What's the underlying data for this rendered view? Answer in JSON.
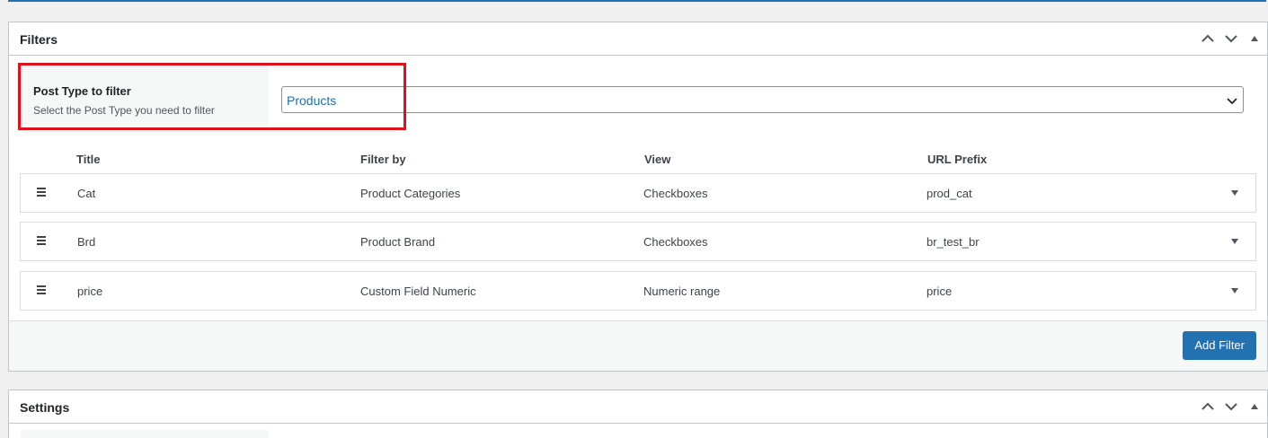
{
  "filters_box": {
    "title": "Filters",
    "post_type": {
      "label": "Post Type to filter",
      "description": "Select the Post Type you need to filter",
      "selected": "Products"
    },
    "columns": [
      "Title",
      "Filter by",
      "View",
      "URL Prefix"
    ],
    "rows": [
      {
        "title": "Cat",
        "filter_by": "Product Categories",
        "view": "Checkboxes",
        "url_prefix": "prod_cat"
      },
      {
        "title": "Brd",
        "filter_by": "Product Brand",
        "view": "Checkboxes",
        "url_prefix": "br_test_br"
      },
      {
        "title": "price",
        "filter_by": "Custom Field Numeric",
        "view": "Numeric range",
        "url_prefix": "price"
      }
    ],
    "add_filter_label": "Add Filter"
  },
  "settings_box": {
    "title": "Settings"
  },
  "colors": {
    "accent": "#2271b1",
    "highlight": "#e0101c",
    "border": "#c3c4c7",
    "background": "#f0f0f1"
  },
  "icons": {
    "move_up": "chevron-up-icon",
    "move_down": "chevron-down-icon",
    "toggle_panel": "triangle-up-icon",
    "row_toggle": "triangle-down-icon",
    "drag": "drag-handle-icon",
    "select_arrow": "chevron-down-icon"
  }
}
